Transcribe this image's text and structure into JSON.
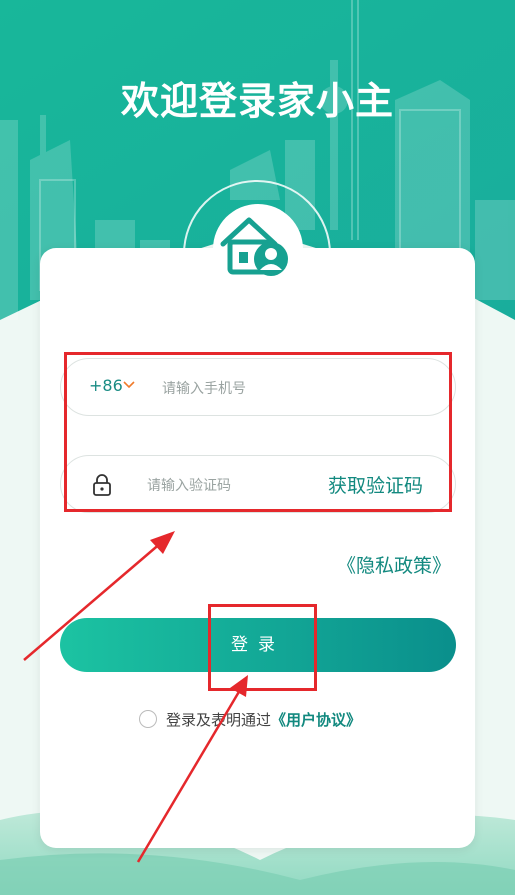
{
  "header": {
    "title": "欢迎登录家小主"
  },
  "logo": {
    "icon": "house-user-icon"
  },
  "form": {
    "phone_prefix": "+86",
    "phone_placeholder": "请输入手机号",
    "code_placeholder": "请输入验证码",
    "get_code_label": "获取验证码"
  },
  "privacy_link": "《隐私政策》",
  "login_button": "登录",
  "agreement": {
    "text": "登录及表明通过",
    "link": "《用户协议》"
  },
  "colors": {
    "brand": "#12897f",
    "gradient_start": "#1cc3a2",
    "gradient_end": "#0a8f8c",
    "annotation": "#e5282c"
  }
}
